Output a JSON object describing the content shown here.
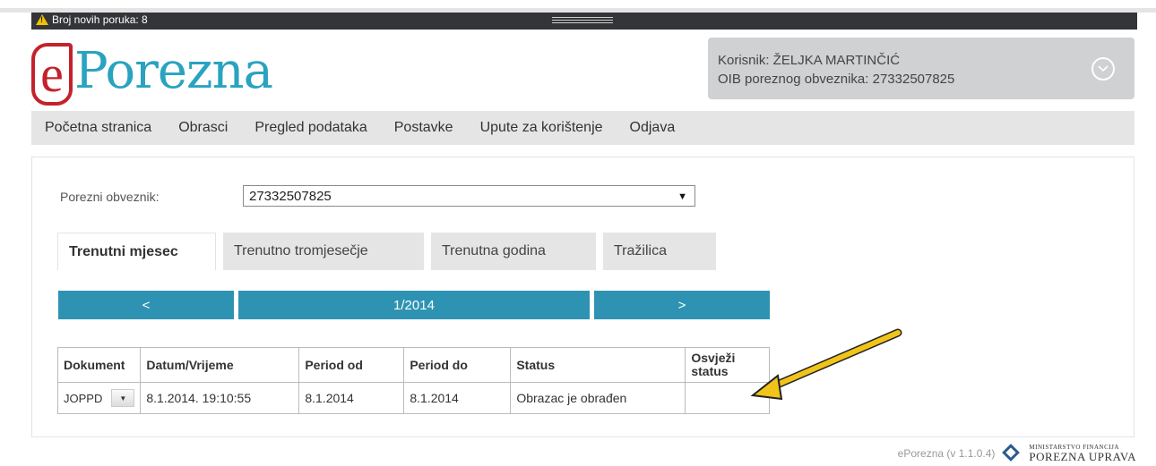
{
  "topbar": {
    "message": "Broj novih poruka: 8"
  },
  "logo": {
    "letter": "e",
    "text": "Porezna"
  },
  "user": {
    "line1": "Korisnik: ŽELJKA MARTINČIĆ",
    "line2": "OIB poreznog obveznika: 27332507825"
  },
  "nav": [
    "Početna stranica",
    "Obrasci",
    "Pregled podataka",
    "Postavke",
    "Upute za korištenje",
    "Odjava"
  ],
  "form": {
    "label": "Porezni obveznik:",
    "value": "27332507825"
  },
  "tabs": [
    "Trenutni mjesec",
    "Trenutno tromjesečje",
    "Trenutna godina",
    "Tražilica"
  ],
  "pager": {
    "prev": "<",
    "current": "1/2014",
    "next": ">"
  },
  "table": {
    "headers": [
      "Dokument",
      "Datum/Vrijeme",
      "Period od",
      "Period do",
      "Status",
      "Osvježi status"
    ],
    "rows": [
      [
        "JOPPD",
        "8.1.2014. 19:10:55",
        "8.1.2014",
        "8.1.2014",
        "Obrazac je obrađen",
        ""
      ]
    ]
  },
  "footer": {
    "version": "ePorezna (v 1.1.0.4)",
    "org_small": "MINISTARSTVO FINANCIJA",
    "org_big": "POREZNA UPRAVA"
  },
  "colors": {
    "accent": "#2e93b3",
    "logo_red": "#c4222b",
    "logo_blue": "#29a3c0",
    "arrow": "#f0c419"
  }
}
